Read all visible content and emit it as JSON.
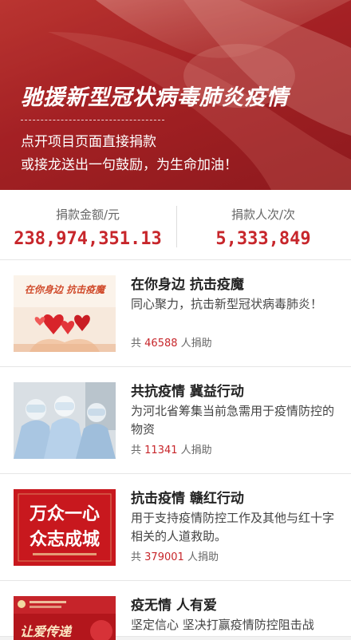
{
  "hero": {
    "title": "驰援新型冠状病毒肺炎疫情",
    "subtitle_1": "点开项目页面直接捐款",
    "subtitle_2": "或接龙送出一句鼓励，为生命加油！"
  },
  "stats": {
    "amount_label": "捐款金额/元",
    "amount_value": "238,974,351.13",
    "count_label": "捐款人次/次",
    "count_value": "5,333,849"
  },
  "projects": [
    {
      "title": "在你身边 抗击疫魔",
      "desc": "同心聚力，抗击新型冠状病毒肺炎！",
      "meta_prefix": "共",
      "count": "46588",
      "meta_suffix": "人捐助",
      "thumb_text": "在你身边 抗击疫魔",
      "thumb_icon": "hearts-hands-image"
    },
    {
      "title": "共抗疫情 冀益行动",
      "desc": "为河北省筹集当前急需用于疫情防控的物资",
      "meta_prefix": "共",
      "count": "11341",
      "meta_suffix": "人捐助",
      "thumb_icon": "medical-staff-photo"
    },
    {
      "title": "抗击疫情 赣红行动",
      "desc": "用于支持疫情防控工作及其他与红十字相关的人道救助。",
      "meta_prefix": "共",
      "count": "379001",
      "meta_suffix": "人捐助",
      "thumb_line1": "万众一心",
      "thumb_line2": "众志成城",
      "thumb_icon": "slogan-banner-image"
    },
    {
      "title": "疫无情 人有爱",
      "desc": "坚定信心 坚决打赢疫情防控阻击战",
      "thumb_text": "让爱传递",
      "thumb_icon": "love-relay-image"
    }
  ],
  "colors": {
    "accent": "#c7262b",
    "hero_bg": "#a82226"
  }
}
